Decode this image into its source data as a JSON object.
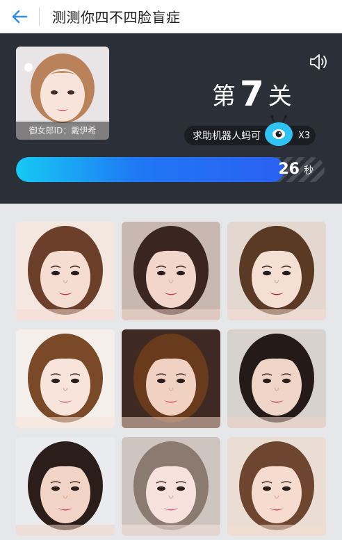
{
  "header": {
    "title": "测测你四不四脸盲症",
    "back_icon": "arrow-left-icon"
  },
  "target": {
    "caption": "御女郎ID：戴伊希",
    "icon": "target-face-photo"
  },
  "level": {
    "prefix": "第",
    "number": "7",
    "suffix": "关"
  },
  "helper": {
    "label": "求助机器人蚂可",
    "count": "X3",
    "icon": "robot-mascot-icon"
  },
  "timer": {
    "seconds": "26",
    "unit": "秒",
    "remaining_fraction": 0.87
  },
  "sound": {
    "icon": "speaker-icon"
  },
  "grid": {
    "cards": [
      {
        "icon": "face-photo-1",
        "hair": "#6b3f2a",
        "bg": "#f3e7df",
        "skin": "#f6ddd1",
        "lip": "#c4254c"
      },
      {
        "icon": "face-photo-2",
        "hair": "#3a2520",
        "bg": "#c8b8b0",
        "skin": "#f2d6cb",
        "lip": "#b63a55"
      },
      {
        "icon": "face-photo-3",
        "hair": "#5a3a25",
        "bg": "#e2d8cf",
        "skin": "#f5dfd3",
        "lip": "#a31832"
      },
      {
        "icon": "face-photo-4",
        "hair": "#7a4a28",
        "bg": "#f4efea",
        "skin": "#f8e4da",
        "lip": "#d0506a"
      },
      {
        "icon": "face-photo-5",
        "hair": "#6a3a1c",
        "bg": "#3e2a22",
        "skin": "#f1d2c2",
        "lip": "#d9464e"
      },
      {
        "icon": "face-photo-6",
        "hair": "#241a18",
        "bg": "#d7d2ce",
        "skin": "#efd4c8",
        "lip": "#b23a4a"
      },
      {
        "icon": "face-photo-7",
        "hair": "#2b1e1a",
        "bg": "#e9ebee",
        "skin": "#f1d4c6",
        "lip": "#c83a45"
      },
      {
        "icon": "face-photo-8",
        "hair": "#8a7a70",
        "bg": "#cfc5c0",
        "skin": "#f7e1dc",
        "lip": "#d64f7b"
      },
      {
        "icon": "face-photo-9",
        "hair": "#6e4630",
        "bg": "#e9ddd4",
        "skin": "#f5dccf",
        "lip": "#d33b48"
      }
    ]
  },
  "colors": {
    "panel": "#2b3038",
    "accent": "#1f78f4",
    "page": "#e5e7e8"
  }
}
